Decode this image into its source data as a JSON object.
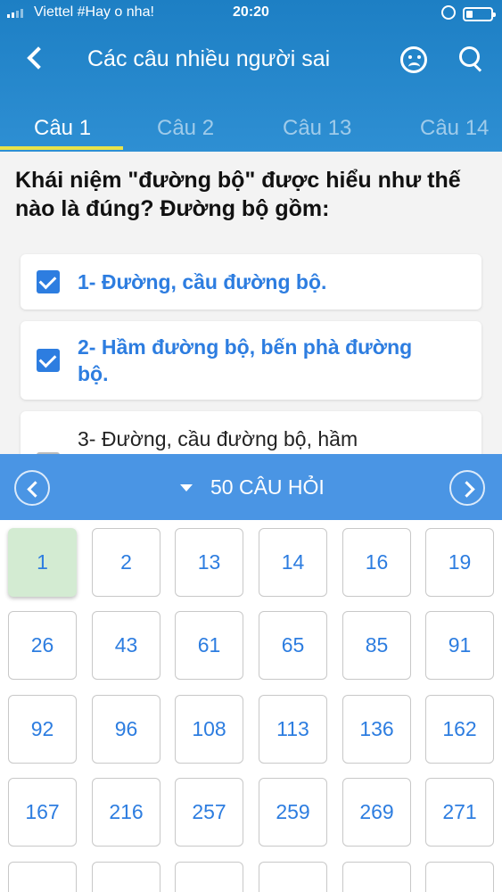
{
  "status_bar": {
    "carrier": "Viettel #Hay o nha!",
    "time": "20:20"
  },
  "header": {
    "title": "Các câu nhiều người sai",
    "icons": [
      "back-arrow",
      "sad-face",
      "search"
    ]
  },
  "tabs": [
    {
      "label": "Câu 1",
      "active": true
    },
    {
      "label": "Câu 2",
      "active": false
    },
    {
      "label": "Câu 13",
      "active": false
    },
    {
      "label": "Câu 14",
      "active": false
    }
  ],
  "question": {
    "text": "Khái niệm \"đường bộ\" được hiểu như thế nào là đúng? Đường bộ gồm:",
    "options": [
      {
        "text": "1- Đường, cầu đường bộ.",
        "checked": true
      },
      {
        "text": "2- Hầm đường bộ, bến phà đường bộ.",
        "checked": true
      },
      {
        "text": "3- Đường, cầu đường bộ, hầm",
        "checked": false
      }
    ]
  },
  "question_panel": {
    "title": "50 CÂU HỎI",
    "numbers": [
      "1",
      "2",
      "13",
      "14",
      "16",
      "19",
      "26",
      "43",
      "61",
      "65",
      "85",
      "91",
      "92",
      "96",
      "108",
      "113",
      "136",
      "162",
      "167",
      "216",
      "257",
      "259",
      "269",
      "271",
      "",
      "",
      "",
      "",
      "",
      ""
    ],
    "current": "1"
  },
  "colors": {
    "header": "#2585cc",
    "accent": "#2d7de0",
    "tab_indicator": "#e9e34a",
    "panel_bar": "#4a95e4",
    "current_cell": "#d3ebd2"
  }
}
